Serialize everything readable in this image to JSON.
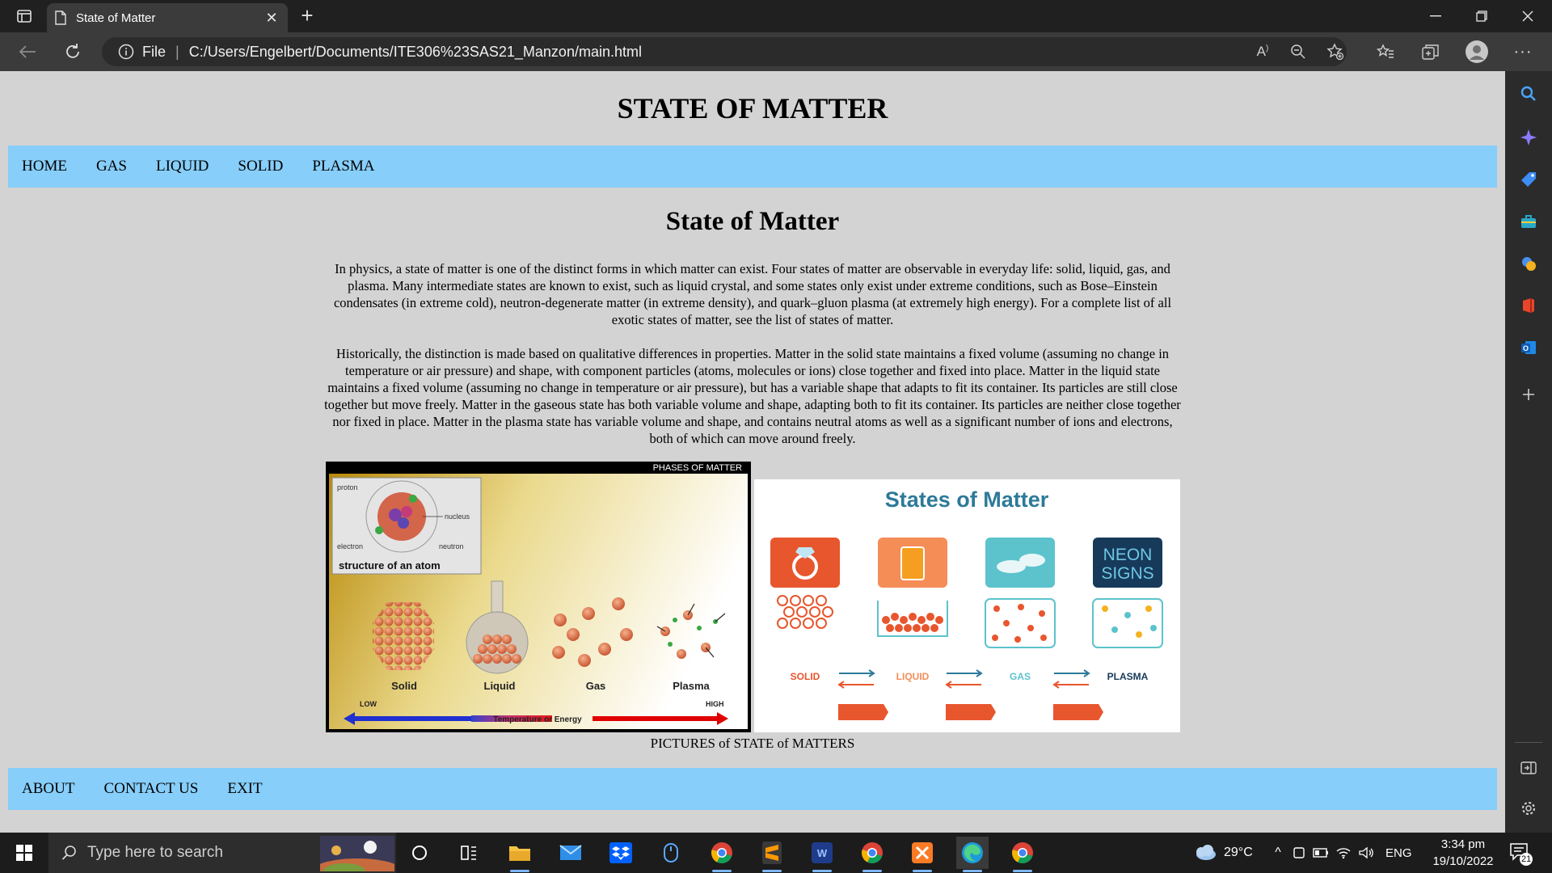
{
  "browser": {
    "tab_title": "State of Matter",
    "address_prefix": "File",
    "url": "C:/Users/Engelbert/Documents/ITE306%23SAS21_Manzon/main.html"
  },
  "page": {
    "site_title": "STATE OF MATTER",
    "top_nav": [
      "HOME",
      "GAS",
      "LIQUID",
      "SOLID",
      "PLASMA"
    ],
    "heading": "State of Matter",
    "paragraph1": "In physics, a state of matter is one of the distinct forms in which matter can exist. Four states of matter are observable in everyday life: solid, liquid, gas, and plasma. Many intermediate states are known to exist, such as liquid crystal, and some states only exist under extreme conditions, such as Bose–Einstein condensates (in extreme cold), neutron-degenerate matter (in extreme density), and quark–gluon plasma (at extremely high energy). For a complete list of all exotic states of matter, see the list of states of matter.",
    "paragraph2": "Historically, the distinction is made based on qualitative differences in properties. Matter in the solid state maintains a fixed volume (assuming no change in temperature or air pressure) and shape, with component particles (atoms, molecules or ions) close together and fixed into place. Matter in the liquid state maintains a fixed volume (assuming no change in temperature or air pressure), but has a variable shape that adapts to fit its container. Its particles are still close together but move freely. Matter in the gaseous state has both variable volume and shape, adapting both to fit its container. Its particles are neither close together nor fixed in place. Matter in the plasma state has variable volume and shape, and contains neutral atoms as well as a significant number of ions and electrons, both of which can move around freely.",
    "image1": {
      "banner": "PHASES OF MATTER",
      "atom_caption": "structure of an atom",
      "labels": {
        "proton": "proton",
        "nucleus": "nucleus",
        "electron": "electron",
        "neutron": "neutron"
      },
      "phases": [
        "Solid",
        "Liquid",
        "Gas",
        "Plasma"
      ],
      "low": "LOW",
      "high": "HIGH",
      "axis": "Temperature or Energy"
    },
    "image2": {
      "title": "States of Matter",
      "neon_line1": "NEON",
      "neon_line2": "SIGNS",
      "states": [
        "SOLID",
        "LIQUID",
        "GAS",
        "PLASMA"
      ]
    },
    "caption": "PICTURES of STATE of MATTERS",
    "footer_nav": [
      "ABOUT",
      "CONTACT US",
      "EXIT"
    ]
  },
  "taskbar": {
    "search_placeholder": "Type here to search",
    "weather": "29°C",
    "language": "ENG",
    "time": "3:34 pm",
    "date": "19/10/2022",
    "notifications": "21"
  },
  "colors": {
    "nav_bar": "#87cefa",
    "page_background": "#d3d3d3",
    "browser_chrome": "#3b3b3b"
  }
}
